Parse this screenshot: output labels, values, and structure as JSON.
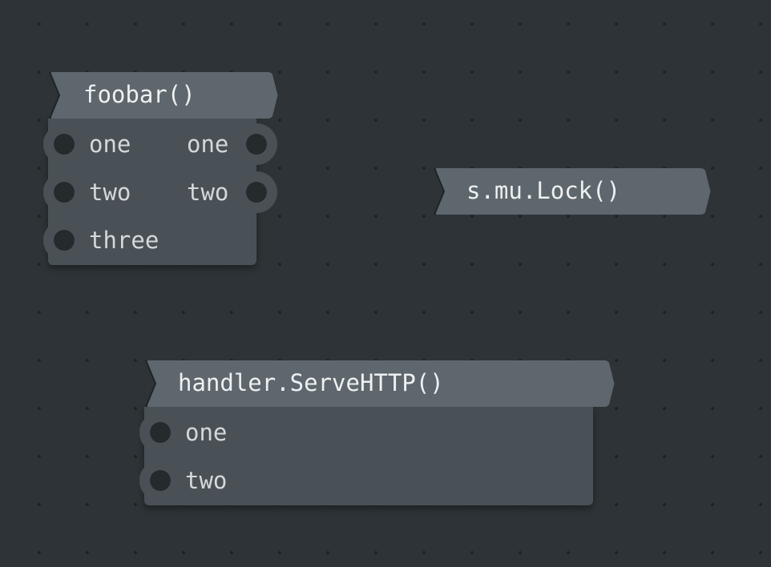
{
  "nodes": {
    "foobar": {
      "title": "foobar()",
      "inputs": [
        "one",
        "two",
        "three"
      ],
      "outputs": [
        "one",
        "two"
      ]
    },
    "lock": {
      "title": "s.mu.Lock()"
    },
    "handler": {
      "title": "handler.ServeHTTP()",
      "inputs": [
        "one",
        "two"
      ]
    }
  },
  "colors": {
    "background": "#2d3336",
    "grid_dot": "#1c2022",
    "node_header": "#5e676d",
    "node_body": "#4a5156",
    "port_hole": "#252a2c"
  }
}
